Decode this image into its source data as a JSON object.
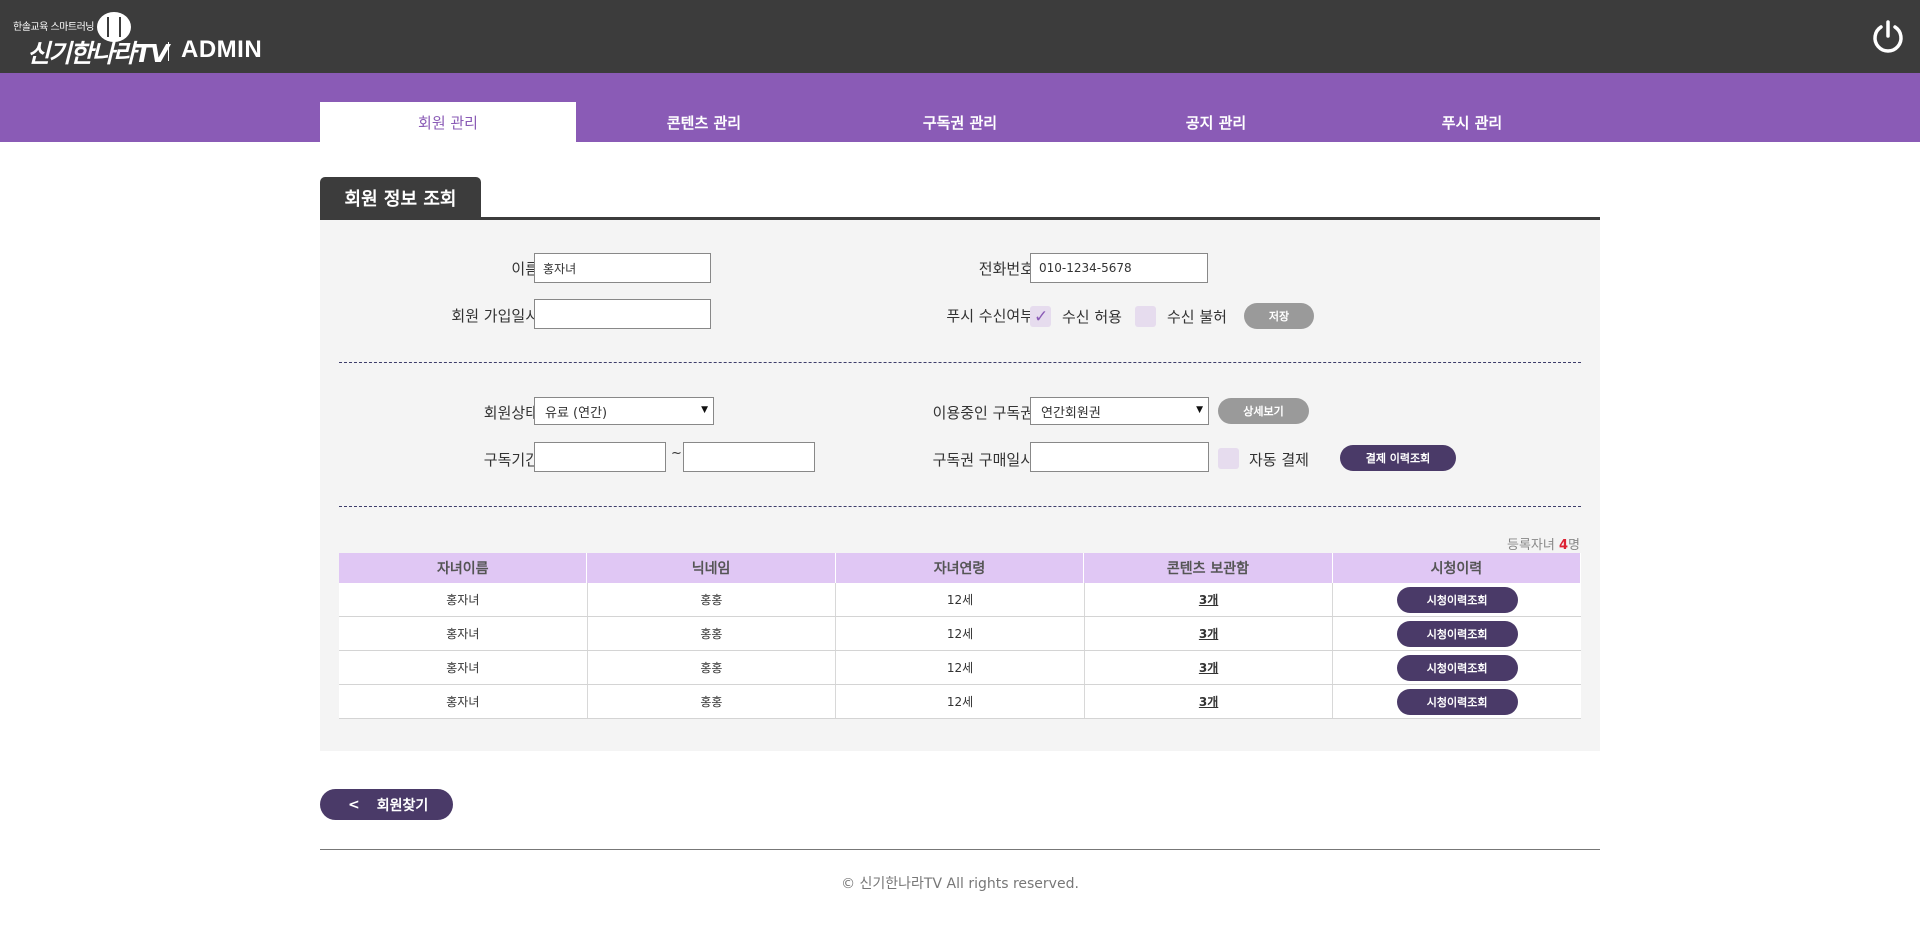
{
  "header": {
    "logo_tagline": "한솔교육 스마트러닝",
    "logo_name": "신기한나라TV",
    "admin_label": "ADMIN",
    "power_icon": "power-icon"
  },
  "nav": {
    "tabs": [
      {
        "label": "회원 관리",
        "active": true
      },
      {
        "label": "콘텐츠 관리",
        "active": false
      },
      {
        "label": "구독권 관리",
        "active": false
      },
      {
        "label": "공지 관리",
        "active": false
      },
      {
        "label": "푸시 관리",
        "active": false
      }
    ]
  },
  "section": {
    "title": "회원 정보 조회"
  },
  "form": {
    "name_label": "이름",
    "name_value": "홍자녀",
    "phone_label": "전화번호",
    "phone_value": "010-1234-5678",
    "join_label": "회원 가입일시",
    "join_value": "",
    "push_label": "푸시 수신여부",
    "push_allow_label": "수신 허용",
    "push_allow_checked": true,
    "push_deny_label": "수신 불허",
    "push_deny_checked": false,
    "save_button": "저장",
    "status_label": "회원상태",
    "status_value": "유료 (연간)",
    "subscription_label": "이용중인 구독권",
    "subscription_value": "연간회원권",
    "detail_button": "상세보기",
    "period_label": "구독기간",
    "period_start": "",
    "period_separator": "~",
    "period_end": "",
    "purchase_label": "구독권 구매일시",
    "purchase_value": "",
    "auto_pay_label": "자동 결제",
    "auto_pay_checked": false,
    "payment_history_button": "결제 이력조회"
  },
  "children": {
    "count_prefix": "등록자녀 ",
    "count": "4",
    "count_suffix": "명",
    "columns": [
      "자녀이름",
      "닉네임",
      "자녀연령",
      "콘텐츠 보관함",
      "시청이력"
    ],
    "rows": [
      {
        "name": "홍자녀",
        "nickname": "홍홍",
        "age": "12세",
        "storage": "3개",
        "history_button": "시청이력조회"
      },
      {
        "name": "홍자녀",
        "nickname": "홍홍",
        "age": "12세",
        "storage": "3개",
        "history_button": "시청이력조회"
      },
      {
        "name": "홍자녀",
        "nickname": "홍홍",
        "age": "12세",
        "storage": "3개",
        "history_button": "시청이력조회"
      },
      {
        "name": "홍자녀",
        "nickname": "홍홍",
        "age": "12세",
        "storage": "3개",
        "history_button": "시청이력조회"
      }
    ]
  },
  "back_button": {
    "chevron": "<",
    "label": "회원찾기"
  },
  "footer": {
    "copyright": "© 신기한나라TV All rights reserved."
  },
  "colors": {
    "topbar": "#3c3c3c",
    "nav_purple": "#8a5bb6",
    "table_header": "#e0c7f4",
    "dark_button": "#4a3a68",
    "gray_button": "#9a9a9a"
  }
}
